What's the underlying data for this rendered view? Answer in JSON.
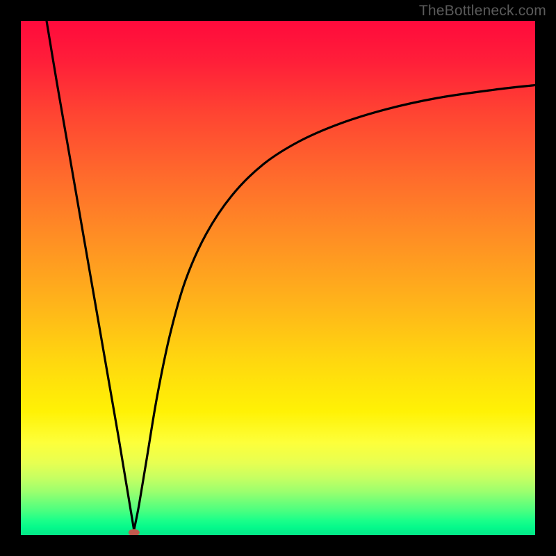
{
  "watermark": "TheBottleneck.com",
  "colors": {
    "page_bg": "#000000",
    "gradient_top": "#ff0a3c",
    "gradient_mid": "#ffd70f",
    "gradient_bottom": "#04e688",
    "curve_stroke": "#000000",
    "marker_fill": "#c15a4e"
  },
  "chart_data": {
    "type": "line",
    "title": "",
    "xlabel": "",
    "ylabel": "",
    "xlim": [
      0,
      100
    ],
    "ylim": [
      0,
      100
    ],
    "grid": false,
    "legend": false,
    "marker": {
      "x": 22,
      "y": 0.5
    },
    "series": [
      {
        "name": "left-branch",
        "x": [
          5,
          7,
          9,
          11,
          13,
          15,
          17,
          19,
          20.5,
          21.5,
          22
        ],
        "y": [
          100,
          88,
          76.5,
          65,
          53.5,
          42,
          30.5,
          19,
          10,
          4,
          1
        ]
      },
      {
        "name": "right-branch",
        "x": [
          22,
          23,
          24.5,
          26.5,
          29,
          32,
          36,
          41,
          47,
          54,
          62,
          71,
          81,
          92,
          100
        ],
        "y": [
          1,
          6,
          15,
          27,
          39,
          49.5,
          58.5,
          66,
          72,
          76.5,
          80,
          82.8,
          85,
          86.6,
          87.5
        ]
      }
    ]
  }
}
